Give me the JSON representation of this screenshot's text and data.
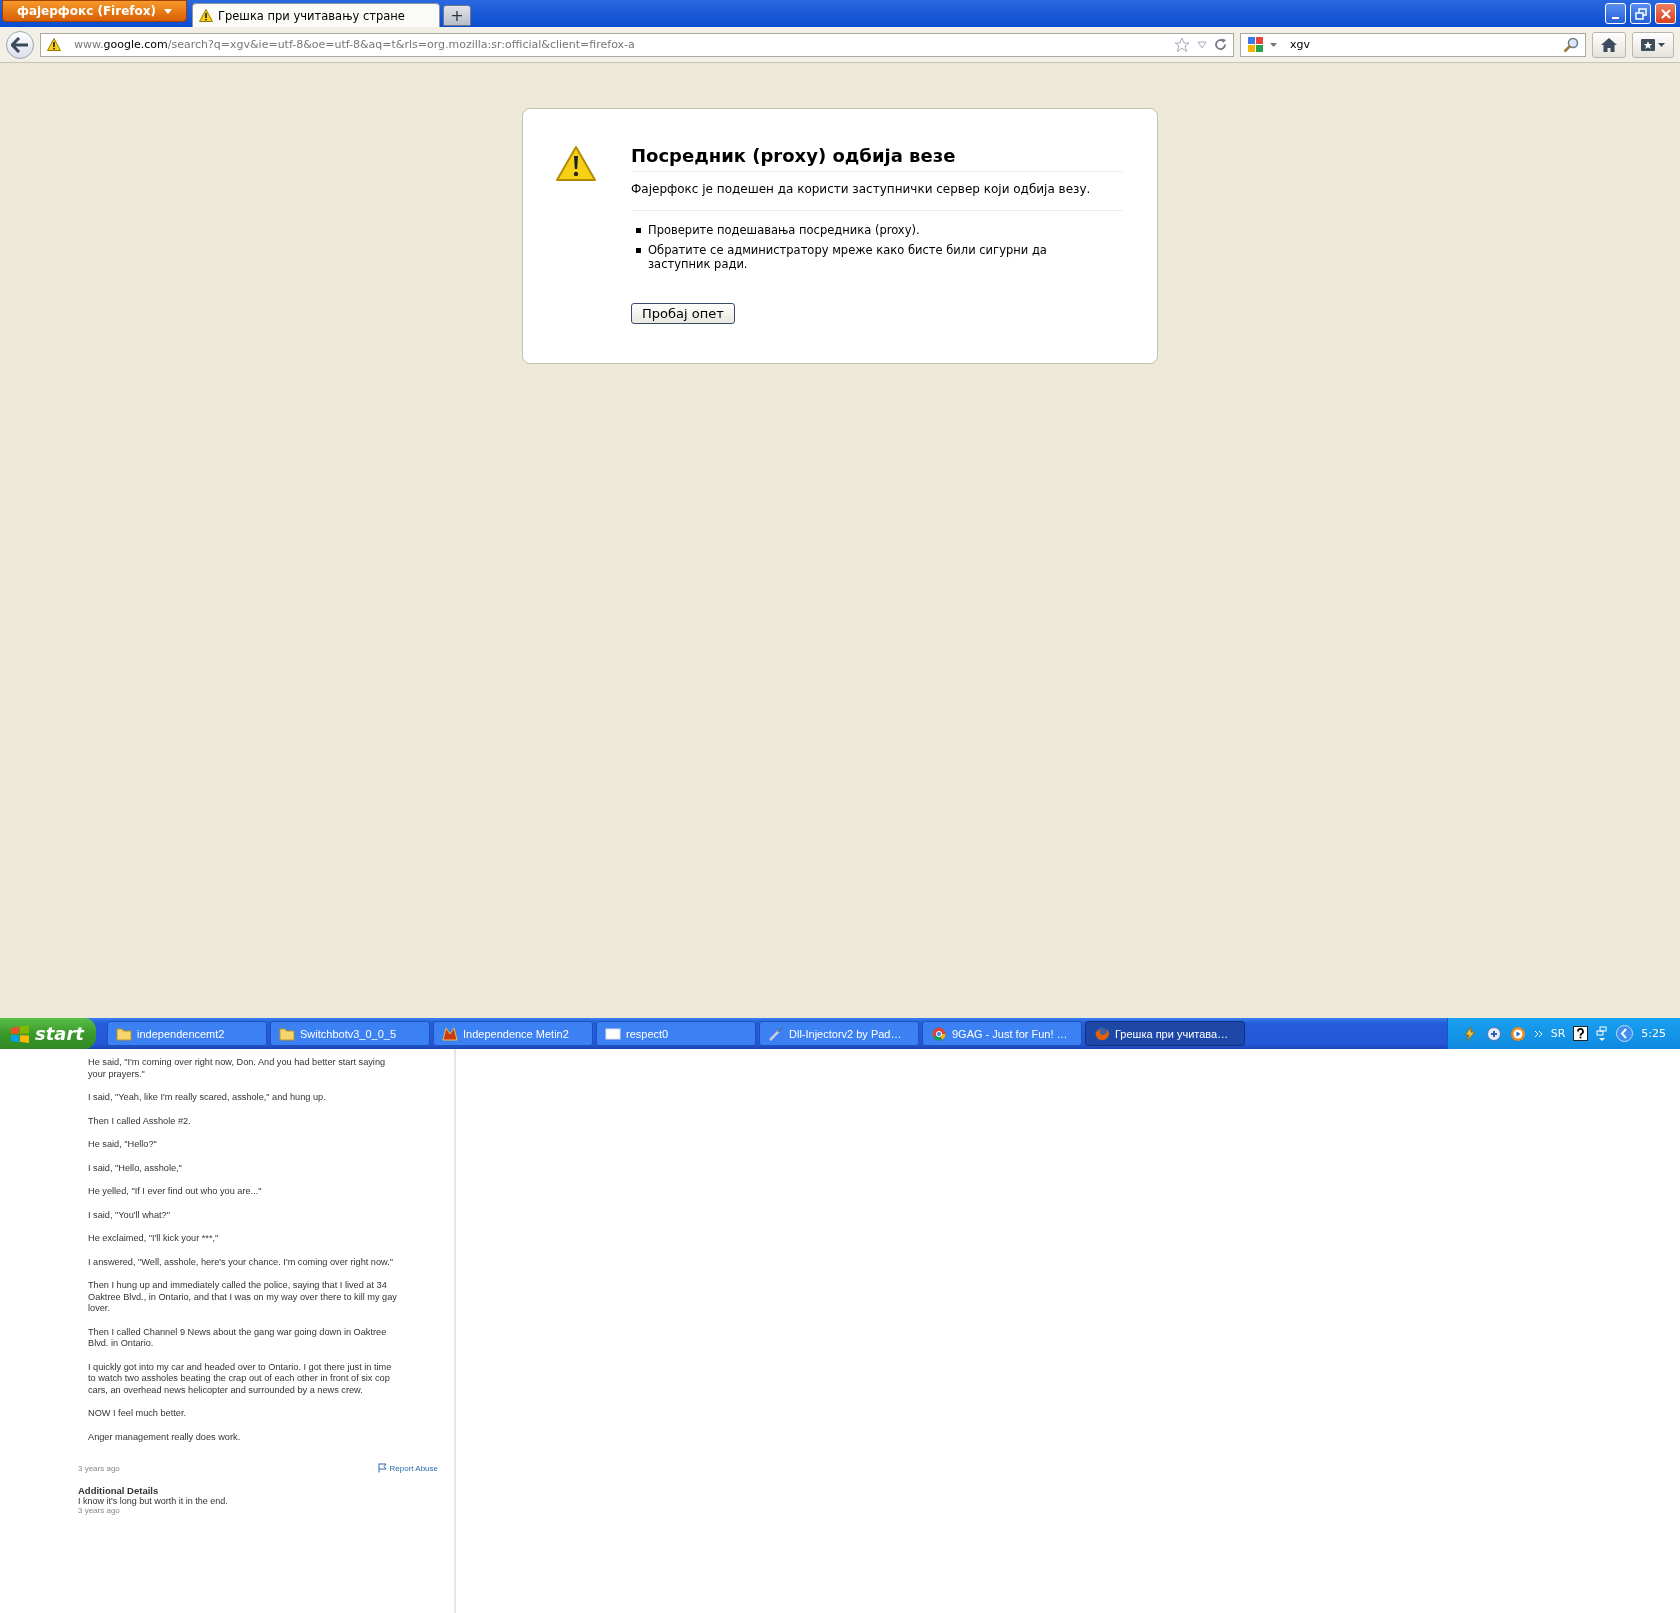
{
  "browser": {
    "app_menu": "фајерфокс (Firefox)",
    "tabs": [
      {
        "label": "Грешка при учитавању стране",
        "selected": true
      }
    ],
    "new_tab": "+",
    "url": "www.**google.com**/search?q=xgv&ie=utf-8&oe=utf-8&aq=t&rls=org.mozilla:sr:official&client=firefox-a",
    "search_value": "xgv"
  },
  "error_page": {
    "title": "Посредник (proxy) одбија везе",
    "message": "Фајерфокс је подешен да користи заступнички сервер који одбија везу.",
    "suggestions": [
      "Проверите подешавања посредника (proxy).",
      "Обратите се администратору мреже како бисте били сигурни да заступник ради."
    ],
    "button": "Пробај опет"
  },
  "taskbar": {
    "start": "start",
    "tasks": [
      {
        "label": "independencemt2",
        "kind": "folder",
        "selected": false
      },
      {
        "label": "Switchbotv3_0_0_5",
        "kind": "folder",
        "selected": false
      },
      {
        "label": "Independence Metin2",
        "kind": "game",
        "selected": false
      },
      {
        "label": "respect0",
        "kind": "window",
        "selected": false
      },
      {
        "label": "Dll-Injectorv2 by Pad…",
        "kind": "tool",
        "selected": false
      },
      {
        "label": "9GAG - Just for Fun! …",
        "kind": "chrome",
        "selected": false
      },
      {
        "label": "Грешка при учитава…",
        "kind": "firefox",
        "selected": true
      }
    ],
    "language": "SR",
    "clock": "5:25"
  },
  "answer": {
    "paragraphs": [
      "He said, \"I'm coming over right now, Don. And you had better start saying your prayers.\"",
      "I said, \"Yeah, like I'm really scared, asshole,\" and hung up.",
      "Then I called Asshole #2.",
      "He said, \"Hello?\"",
      "I said, \"Hello, asshole,\"",
      "He yelled, \"If I ever find out who you are...\"",
      "I said, \"You'll what?\"",
      "He exclaimed, \"I'll kick your ***,\"",
      "I answered, \"Well, asshole, here's your chance. I'm coming over right now.\"",
      "Then I hung up and immediately called the police, saying that I lived at 34 Oaktree Blvd., in Ontario, and that I was on my way over there to kill my gay lover.",
      "Then I called Channel 9 News about the gang war going down in Oaktree Blvd. in Ontario.",
      "I quickly got into my car and headed over to Ontario. I got there just in time to watch two assholes beating the crap out of each other in front of six cop cars, an overhead news helicopter and surrounded by a news crew.",
      "NOW I feel much better.",
      "Anger management really does work."
    ],
    "time": "3 years ago",
    "report": "Report Abuse",
    "details_title": "Additional Details",
    "details_text": "I know it's long but worth it in the end.",
    "details_time": "3 years ago"
  }
}
